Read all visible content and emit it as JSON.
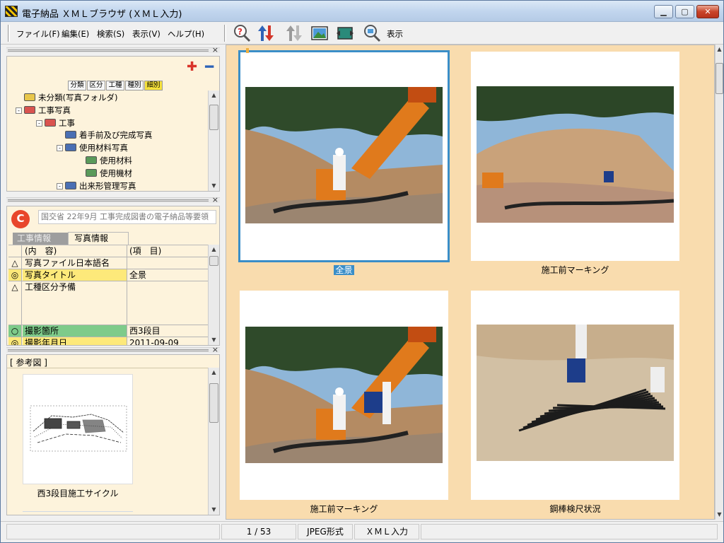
{
  "window": {
    "title": "電子納品 ＸＭＬブラウザ (ＸＭＬ入力)"
  },
  "menu": [
    {
      "id": "file",
      "label": "ファイル(F)"
    },
    {
      "id": "edit",
      "label": "編集(E)"
    },
    {
      "id": "search",
      "label": "検索(S)"
    },
    {
      "id": "view",
      "label": "表示(V)"
    },
    {
      "id": "help",
      "label": "ヘルプ(H)"
    }
  ],
  "toolbar": {
    "display_label": "表示"
  },
  "tree": {
    "tabs": [
      "分類",
      "区分",
      "工種",
      "種別",
      "細別"
    ],
    "active_tab": "細別",
    "items": [
      {
        "label": "未分類(写真フォルダ)",
        "level": 0,
        "toggle": "",
        "color": "#e8c64a"
      },
      {
        "label": "工事写真",
        "level": 0,
        "toggle": "−",
        "color": "#d9534f"
      },
      {
        "label": "工事",
        "level": 1,
        "toggle": "−",
        "color": "#d9534f"
      },
      {
        "label": "着手前及び完成写真",
        "level": 2,
        "toggle": "",
        "color": "#4a6fb3"
      },
      {
        "label": "使用材料写真",
        "level": 2,
        "toggle": "−",
        "color": "#4a6fb3"
      },
      {
        "label": "使用材料",
        "level": 3,
        "toggle": "",
        "color": "#5a9a5a"
      },
      {
        "label": "使用機材",
        "level": 3,
        "toggle": "",
        "color": "#5a9a5a"
      },
      {
        "label": "出来形管理写真",
        "level": 2,
        "toggle": "−",
        "color": "#4a6fb3"
      }
    ]
  },
  "info": {
    "standard": "国交省 22年9月 工事完成図書の電子納品等要領",
    "tabs": {
      "inactive": "工事情報",
      "active": "写真情報"
    },
    "columns": {
      "content": "(内　容)",
      "item": "(項　目)"
    },
    "rows": [
      {
        "sym": "△",
        "name": "写真ファイル日本語名",
        "value": "",
        "bg": "#fdf3dc"
      },
      {
        "sym": "◎",
        "name": "写真タイトル",
        "value": "全景",
        "bg": "#fde97a"
      },
      {
        "sym": "△",
        "name": "工種区分予備",
        "value": "",
        "bg": "#fdf3dc"
      },
      {
        "sym": "○",
        "name": "撮影箇所",
        "value": "西3段目",
        "bg": "#7ecb8a"
      },
      {
        "sym": "◎",
        "name": "撮影年月日",
        "value": "2011-09-09",
        "bg": "#fde97a"
      }
    ]
  },
  "reference": {
    "label": "[ 参考図 ]",
    "caption": "西3段目施工サイクル"
  },
  "photos": [
    {
      "caption": "全景",
      "selected": true,
      "scene": "drill"
    },
    {
      "caption": "施工前マーキング",
      "selected": false,
      "scene": "slope"
    },
    {
      "caption": "施工前マーキング",
      "selected": false,
      "scene": "drill2"
    },
    {
      "caption": "鋼棒検尺状況",
      "selected": false,
      "scene": "bars"
    }
  ],
  "status": {
    "page": "1 / 53",
    "format": "JPEG形式",
    "mode": "ＸＭＬ入力"
  }
}
